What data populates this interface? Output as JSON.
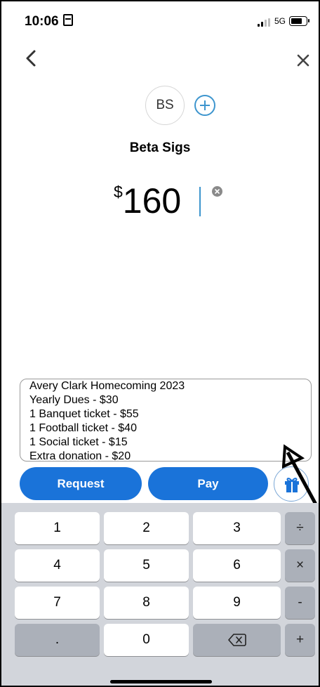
{
  "status_bar": {
    "time": "10:06",
    "network": "5G",
    "battery_icon": "battery-icon",
    "signal_icon": "signal-icon"
  },
  "nav": {
    "back_icon": "chevron-left-icon",
    "close_icon": "close-icon"
  },
  "recipient": {
    "initials": "BS",
    "name": "Beta Sigs"
  },
  "amount": {
    "currency": "$",
    "value": "160"
  },
  "note": {
    "lines": [
      "Avery Clark Homecoming 2023",
      "Yearly Dues - $30",
      "1 Banquet ticket - $55",
      "1 Football ticket - $40",
      "1 Social ticket - $15",
      "Extra donation - $20"
    ]
  },
  "actions": {
    "request_label": "Request",
    "pay_label": "Pay",
    "gift_icon": "gift-icon"
  },
  "keypad": {
    "row1": [
      "1",
      "2",
      "3",
      "÷"
    ],
    "row2": [
      "4",
      "5",
      "6",
      "×"
    ],
    "row3": [
      "7",
      "8",
      "9",
      "-"
    ],
    "row4": [
      ".",
      "0",
      "backspace-icon",
      "+"
    ]
  },
  "colors": {
    "primary": "#1a73d9",
    "accent": "#3d95ce",
    "keyboard_bg": "#d2d5db"
  }
}
